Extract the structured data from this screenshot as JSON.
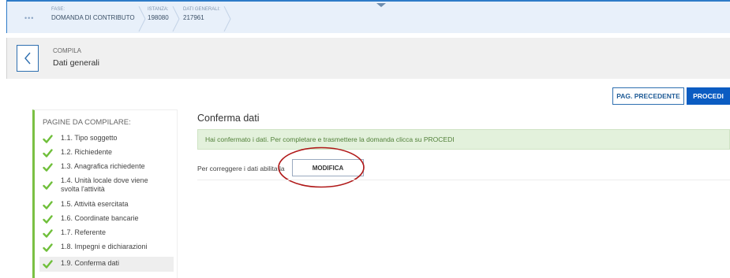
{
  "topbar": {
    "dots": "•••",
    "crumbs": [
      {
        "label": "FASE:",
        "value": "DOMANDA DI CONTRIBUTO"
      },
      {
        "label": "ISTANZA:",
        "value": "198080"
      },
      {
        "label": "DATI GENERALI:",
        "value": "217961"
      }
    ]
  },
  "header": {
    "section_label": "COMPILA",
    "page_title": "Dati generali"
  },
  "actions": {
    "prev_label": "PAG. PRECEDENTE",
    "next_label": "PROCEDI"
  },
  "sidebar": {
    "title": "PAGINE DA COMPILARE:",
    "items": [
      {
        "label": "1.1. Tipo soggetto",
        "checked": true
      },
      {
        "label": "1.2. Richiedente",
        "checked": true
      },
      {
        "label": "1.3. Anagrafica richiedente",
        "checked": true
      },
      {
        "label": "1.4. Unità locale dove viene svolta l'attività",
        "checked": true
      },
      {
        "label": "1.5. Attività esercitata",
        "checked": true
      },
      {
        "label": "1.6. Coordinate bancarie",
        "checked": true
      },
      {
        "label": "1.7. Referente",
        "checked": true
      },
      {
        "label": "1.8. Impegni e dichiarazioni",
        "checked": true
      },
      {
        "label": "1.9. Conferma dati",
        "checked": true,
        "active": true
      }
    ]
  },
  "main": {
    "title": "Conferma dati",
    "alert": "Hai confermato i dati. Per completare e trasmettere la domanda clicca su PROCEDI",
    "fix_text": "Per correggere i dati abilita la",
    "modify_label": "MODIFICA"
  },
  "colors": {
    "accent_blue": "#0b5cc2",
    "check_green": "#6fbf3a",
    "alert_bg": "#e3f1dc",
    "annotation_red": "#b01818"
  }
}
